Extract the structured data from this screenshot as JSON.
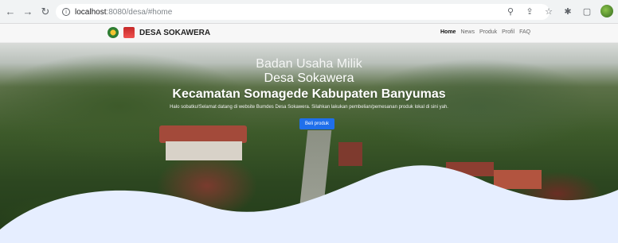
{
  "browser": {
    "url_host": "localhost",
    "url_path": ":8080/desa/#home"
  },
  "site": {
    "brand": "DESA SOKAWERA",
    "menu": [
      "Home",
      "News",
      "Produk",
      "Profil",
      "FAQ"
    ]
  },
  "hero": {
    "title_line1": "Badan Usaha Milik",
    "title_line2": "Desa Sokawera",
    "title_line3": "Kecamatan Somagede Kabupaten Banyumas",
    "subtitle": "Halo sobatku!Selamat datang di website Bumdes Desa Sokawera. Silahkan lakukan pembelian/pemesanan produk lokal di sini yah.",
    "cta_label": "Beli produk"
  },
  "colors": {
    "cta": "#1f6feb",
    "wave": "#e6eeff"
  },
  "icons": [
    "back-icon",
    "forward-icon",
    "reload-icon",
    "info-icon",
    "zoom-icon",
    "share-icon",
    "star-icon",
    "extensions-icon",
    "sidebar-icon",
    "profile-avatar"
  ]
}
